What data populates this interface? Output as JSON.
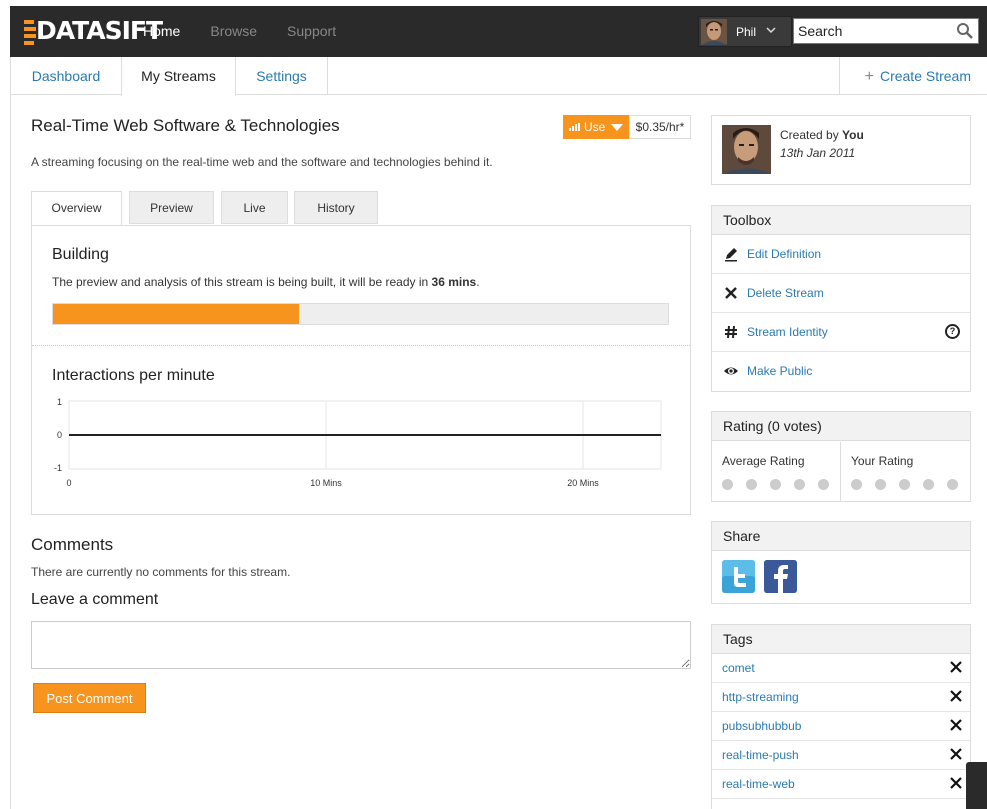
{
  "brand": {
    "logo_text": "DATASIFT",
    "accent": "#f7941d"
  },
  "topnav": {
    "items": [
      "Home",
      "Browse",
      "Support"
    ],
    "active": "Home"
  },
  "user": {
    "name": "Phil"
  },
  "search": {
    "placeholder": "Search"
  },
  "subnav": {
    "items": [
      "Dashboard",
      "My Streams",
      "Settings"
    ],
    "active": "My Streams",
    "create_label": "Create Stream"
  },
  "stream": {
    "title": "Real-Time Web Software & Technologies",
    "use_label": "Use",
    "price": "$0.35/hr*",
    "description": "A streaming focusing on the real-time web and the software and technologies behind it."
  },
  "tabs": [
    "Overview",
    "Preview",
    "Live",
    "History"
  ],
  "building": {
    "title": "Building",
    "text_prefix": "The preview and analysis of this stream is being built, it will be ready in ",
    "time": "36 mins",
    "text_suffix": ".",
    "progress": 0.4
  },
  "chart_data": {
    "type": "line",
    "title": "Interactions per minute",
    "y_ticks": [
      "1",
      "0",
      "-1"
    ],
    "x_ticks": [
      "0",
      "10 Mins",
      "20 Mins"
    ],
    "ylim": [
      -1,
      1
    ],
    "x": [
      0,
      23
    ],
    "values": [
      0,
      0
    ]
  },
  "comments": {
    "heading": "Comments",
    "empty": "There are currently no comments for this stream.",
    "leave_heading": "Leave a comment",
    "post_label": "Post Comment"
  },
  "creator": {
    "label": "Created by",
    "name": "You",
    "date": "13th Jan 2011"
  },
  "toolbox": {
    "heading": "Toolbox",
    "items": [
      {
        "label": "Edit Definition",
        "icon": "pencil-icon"
      },
      {
        "label": "Delete Stream",
        "icon": "cross-icon"
      },
      {
        "label": "Stream Identity",
        "icon": "hash-icon"
      },
      {
        "label": "Make Public",
        "icon": "eye-icon"
      }
    ],
    "help_glyph": "?"
  },
  "rating": {
    "heading": "Rating (0 votes)",
    "average_label": "Average Rating",
    "your_label": "Your Rating"
  },
  "share": {
    "heading": "Share"
  },
  "tags": {
    "heading": "Tags",
    "items": [
      "comet",
      "http-streaming",
      "pubsubhubbub",
      "real-time-push",
      "real-time-web"
    ]
  }
}
